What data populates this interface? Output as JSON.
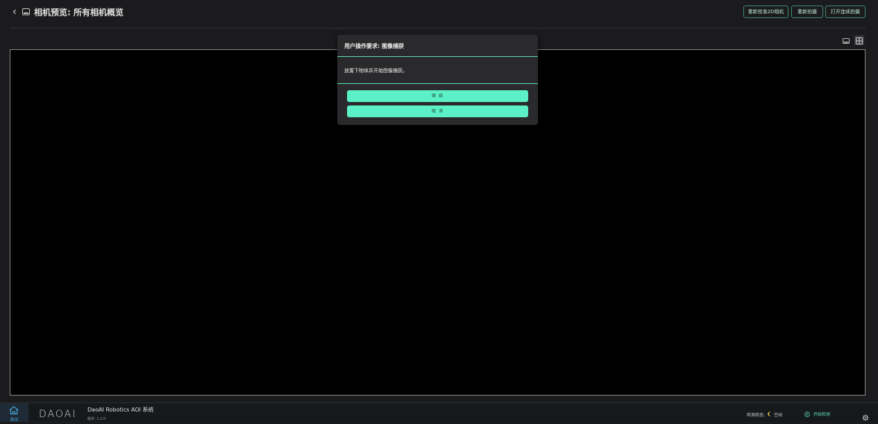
{
  "header": {
    "title": "相机预览: 所有相机概览",
    "buttons": {
      "recalibrate": "重新校准2D相机",
      "recapture": "重新拍摄",
      "continuous": "打开连续拍摄"
    }
  },
  "dialog": {
    "title": "用户操作要求: 图像捕获",
    "message": "放置下物体并开始图像捕获。",
    "continue_label": "继 续",
    "cancel_label": "取 消"
  },
  "footer": {
    "home_label": "首页",
    "logo_text": "DAOAI",
    "app_name": "DaoAI Robotics AOI 系统",
    "version": "版本: 1.2.0",
    "status_label": "检测状态:",
    "status_value": "空闲",
    "start_label": "开始检测"
  },
  "colors": {
    "accent": "#5bf0c6",
    "background": "#1b1b1d",
    "preview_bg": "#000000",
    "dialog_bg": "#2a2a2c"
  },
  "icons": {
    "back": "chevron-left-icon",
    "title": "monitor-icon",
    "view_single": "single-view-icon",
    "view_grid": "grid-view-icon",
    "home": "home-icon",
    "status": "moon-icon",
    "start": "play-circle-icon",
    "settings": "gear-icon"
  }
}
